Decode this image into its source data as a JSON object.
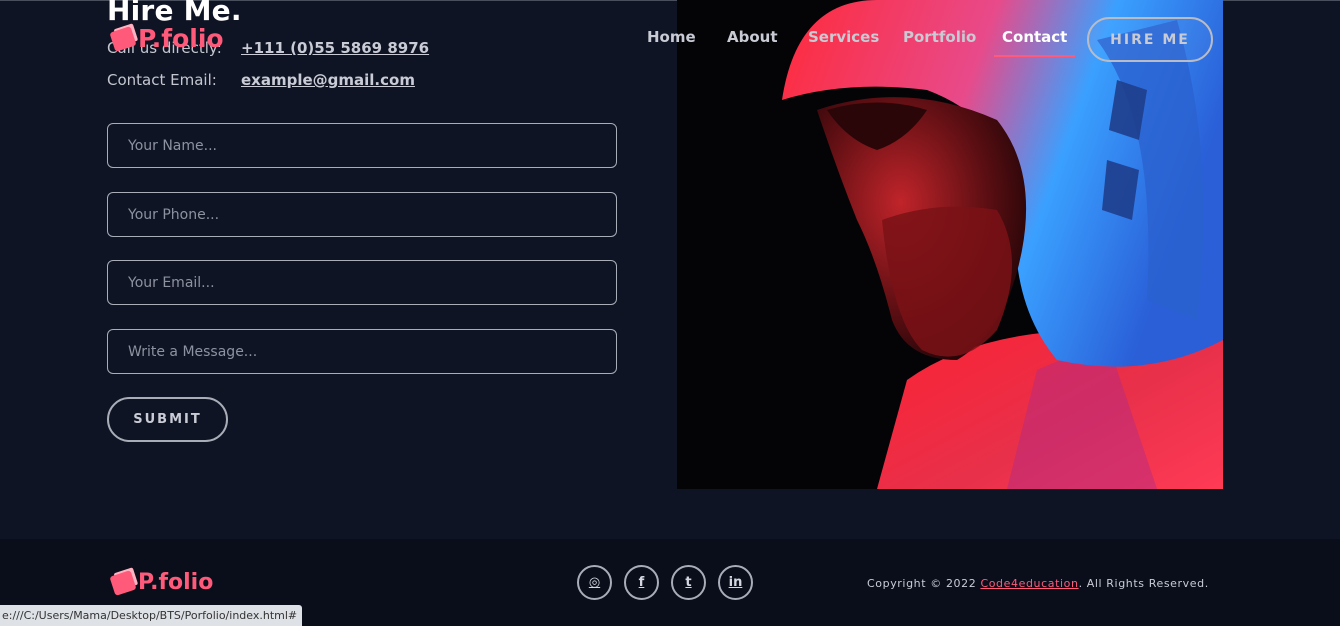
{
  "header": {
    "logo": "P.folio",
    "nav": [
      {
        "label": "Home"
      },
      {
        "label": "About"
      },
      {
        "label": "Services"
      },
      {
        "label": "Portfolio"
      },
      {
        "label": "Contact",
        "active": true
      }
    ],
    "hire_button": "HIRE ME"
  },
  "contact": {
    "title": "Hire Me.",
    "call_label": "Call us directly:",
    "phone": "+111 (0)55 5869 8976",
    "email_label": "Contact Email:",
    "email": "example@gmail.com",
    "form": {
      "name_placeholder": "Your Name...",
      "phone_placeholder": "Your Phone...",
      "email_placeholder": "Your Email...",
      "message_placeholder": "Write a Message...",
      "submit_label": "SUBMIT"
    }
  },
  "footer": {
    "logo": "P.folio",
    "social": [
      {
        "icon": "instagram-icon",
        "glyph": "◎"
      },
      {
        "icon": "facebook-icon",
        "glyph": "f"
      },
      {
        "icon": "twitter-icon",
        "glyph": "t"
      },
      {
        "icon": "linkedin-icon",
        "glyph": "in"
      }
    ],
    "copyright_prefix": "Copyright © 2022 ",
    "copyright_link": "Code4education",
    "copyright_suffix": ". All Rights Reserved."
  },
  "statusbar": {
    "url": "e:///C:/Users/Mama/Desktop/BTS/Porfolio/index.html#"
  },
  "colors": {
    "background": "#0f1424",
    "footer": "#0a0e1b",
    "accent": "#ff5a7a"
  }
}
